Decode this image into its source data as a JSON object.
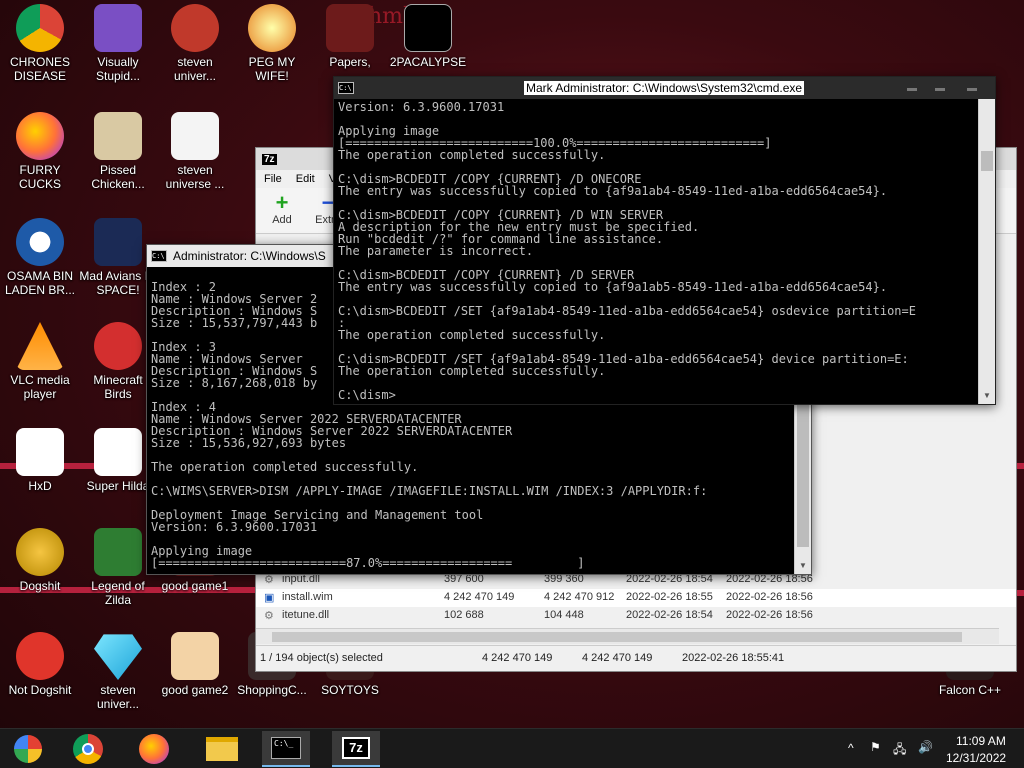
{
  "desktop_icons": [
    {
      "label": "CHRONES DISEASE",
      "icon": "chrome-icon"
    },
    {
      "label": "Visually Stupid...",
      "icon": "visual-studio-icon"
    },
    {
      "label": "steven univer...",
      "icon": "steven-universe-icon"
    },
    {
      "label": "PEG MY WIFE!",
      "icon": "peggle-icon"
    },
    {
      "label": "Papers,",
      "icon": "papers-please-icon"
    },
    {
      "label": "2PACALYPSE",
      "icon": "cmd-icon"
    },
    {
      "label": "FURRY CUCKS",
      "icon": "firefox-icon"
    },
    {
      "label": "Pissed Chicken...",
      "icon": "angry-birds-seasons-icon"
    },
    {
      "label": "steven universe ...",
      "icon": "blank-file-icon"
    },
    {
      "label": "OSAMA BIN LADEN BR...",
      "icon": "obama-logo-icon"
    },
    {
      "label": "Mad Avians IN SPACE!",
      "icon": "angry-birds-space-icon"
    },
    {
      "label": "VLC media player",
      "icon": "vlc-icon"
    },
    {
      "label": "Minecraft Birds",
      "icon": "angry-birds-icon"
    },
    {
      "label": "HxD",
      "icon": "hxd-icon"
    },
    {
      "label": "Super Hilda",
      "icon": "pixel-cat-icon"
    },
    {
      "label": "Dogshit",
      "icon": "dev-cpp-icon"
    },
    {
      "label": "Legend of Zilda",
      "icon": "zelda-sprite-icon"
    },
    {
      "label": "good game1",
      "icon": "game-icon"
    },
    {
      "label": "Not Dogshit",
      "icon": "dev-cpp-red-icon"
    },
    {
      "label": "steven univer...",
      "icon": "diamond-icon"
    },
    {
      "label": "good game2",
      "icon": "torii-icon"
    },
    {
      "label": "ShoppingC...",
      "icon": "shopping-icon"
    },
    {
      "label": "SOYTOYS",
      "icon": "soytoys-icon"
    },
    {
      "label": "Falcon C++",
      "icon": "falcon-icon"
    }
  ],
  "cmd_main": {
    "title": "Mark Administrator: C:\\Windows\\System32\\cmd.exe",
    "lines": [
      "Version: 6.3.9600.17031",
      "",
      "Applying image",
      "[==========================100.0%==========================]",
      "The operation completed successfully.",
      "",
      "C:\\dism>BCDEDIT /COPY {CURRENT} /D ONECORE",
      "The entry was successfully copied to {af9a1ab4-8549-11ed-a1ba-edd6564cae54}.",
      "",
      "C:\\dism>BCDEDIT /COPY {CURRENT} /D WIN SERVER",
      "A description for the new entry must be specified.",
      "Run \"bcdedit /?\" for command line assistance.",
      "The parameter is incorrect.",
      "",
      "C:\\dism>BCDEDIT /COPY {CURRENT} /D SERVER",
      "The entry was successfully copied to {af9a1ab5-8549-11ed-a1ba-edd6564cae54}.",
      "",
      "C:\\dism>BCDEDIT /SET {af9a1ab4-8549-11ed-a1ba-edd6564cae54} osdevice partition=E",
      ":",
      "The operation completed successfully.",
      "",
      "C:\\dism>BCDEDIT /SET {af9a1ab4-8549-11ed-a1ba-edd6564cae54} device partition=E:",
      "The operation completed successfully.",
      "",
      "C:\\dism>"
    ]
  },
  "cmd_second": {
    "title": "Administrator: C:\\Windows\\S",
    "lines": [
      "",
      "Index : 2",
      "Name : Windows Server 2",
      "Description : Windows S",
      "Size : 15,537,797,443 b",
      "",
      "Index : 3",
      "Name : Windows Server",
      "Description : Windows S",
      "Size : 8,167,268,018 by",
      "",
      "Index : 4",
      "Name : Windows Server 2022 SERVERDATACENTER",
      "Description : Windows Server 2022 SERVERDATACENTER",
      "Size : 15,536,927,693 bytes",
      "",
      "The operation completed successfully.",
      "",
      "C:\\WIMS\\SERVER>DISM /APPLY-IMAGE /IMAGEFILE:INSTALL.WIM /INDEX:3 /APPLYDIR:f:",
      "",
      "Deployment Image Servicing and Management tool",
      "Version: 6.3.9600.17031",
      "",
      "Applying image",
      "[==========================87.0%==================         ]"
    ]
  },
  "zip_window": {
    "title": "7z",
    "menu": [
      "File",
      "Edit",
      "V"
    ],
    "toolbar": [
      {
        "label": "Add",
        "glyph": "+"
      },
      {
        "label": "Extra",
        "glyph": "−"
      }
    ],
    "files": [
      {
        "name": "input.dll",
        "size": "397 600",
        "packed": "399 360",
        "modified": "2022-02-26 18:54",
        "created": "2022-02-26 18:56"
      },
      {
        "name": "install.wim",
        "size": "4 242 470 149",
        "packed": "4 242 470 912",
        "modified": "2022-02-26 18:55",
        "created": "2022-02-26 18:56"
      },
      {
        "name": "itetune.dll",
        "size": "102 688",
        "packed": "104 448",
        "modified": "2022-02-26 18:54",
        "created": "2022-02-26 18:56"
      }
    ],
    "status": {
      "selected": "1 / 194 object(s) selected",
      "size": "4 242 470 149",
      "packed": "4 242 470 149",
      "date": "2022-02-26 18:55:41"
    }
  },
  "taskbar": {
    "apps": [
      "start-icon",
      "chrome-icon",
      "firefox-icon",
      "explorer-icon",
      "cmd-icon",
      "7zip-icon"
    ],
    "zip_label": "7z",
    "cmd_label": "C:\\_",
    "time": "11:09 AM",
    "date": "12/31/2022"
  },
  "wallpaper_text": "hmhh..",
  "colors": {
    "console_bg": "#000000",
    "console_fg": "#c0c0c0",
    "taskbar": "#1a1a1a",
    "accent": "#76b9ed"
  }
}
